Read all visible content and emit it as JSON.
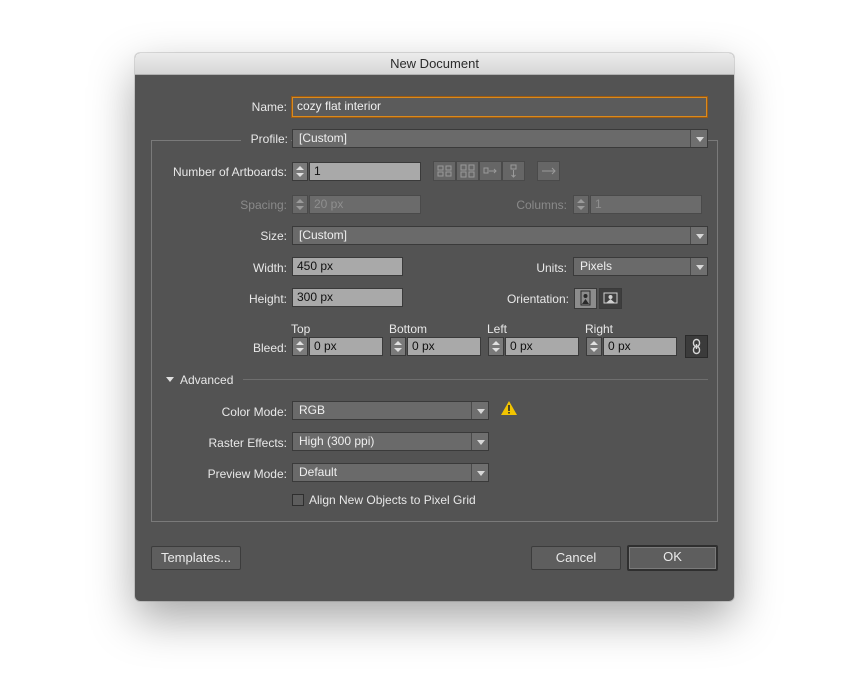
{
  "dialog": {
    "title": "New Document"
  },
  "name": {
    "label": "Name:",
    "value": "cozy flat interior"
  },
  "profile": {
    "label": "Profile:",
    "value": "[Custom]"
  },
  "artboards": {
    "label": "Number of Artboards:",
    "value": "1"
  },
  "spacing": {
    "label": "Spacing:",
    "value": "20 px"
  },
  "columns": {
    "label": "Columns:",
    "value": "1"
  },
  "size": {
    "label": "Size:",
    "value": "[Custom]"
  },
  "width": {
    "label": "Width:",
    "value": "450 px"
  },
  "units": {
    "label": "Units:",
    "value": "Pixels"
  },
  "height": {
    "label": "Height:",
    "value": "300 px"
  },
  "orientation": {
    "label": "Orientation:"
  },
  "bleed": {
    "label": "Bleed:",
    "top": {
      "label": "Top",
      "value": "0 px"
    },
    "bottom": {
      "label": "Bottom",
      "value": "0 px"
    },
    "left": {
      "label": "Left",
      "value": "0 px"
    },
    "right": {
      "label": "Right",
      "value": "0 px"
    }
  },
  "advanced": {
    "label": "Advanced",
    "color_mode": {
      "label": "Color Mode:",
      "value": "RGB"
    },
    "raster_effects": {
      "label": "Raster Effects:",
      "value": "High (300 ppi)"
    },
    "preview_mode": {
      "label": "Preview Mode:",
      "value": "Default"
    },
    "align_pixel_grid": {
      "label": "Align New Objects to Pixel Grid",
      "checked": false
    }
  },
  "buttons": {
    "templates": "Templates...",
    "cancel": "Cancel",
    "ok": "OK"
  },
  "colors": {
    "dialog_bg": "#535353",
    "focus_ring": "#d98a1f",
    "warning": "#f2c400"
  },
  "icons": [
    "grid-by-row-icon",
    "grid-by-column-icon",
    "arrange-by-row-icon",
    "arrange-by-column-icon",
    "right-to-left-icon",
    "portrait-icon",
    "landscape-icon",
    "link-bleed-icon",
    "warning-icon",
    "disclosure-triangle-icon"
  ]
}
